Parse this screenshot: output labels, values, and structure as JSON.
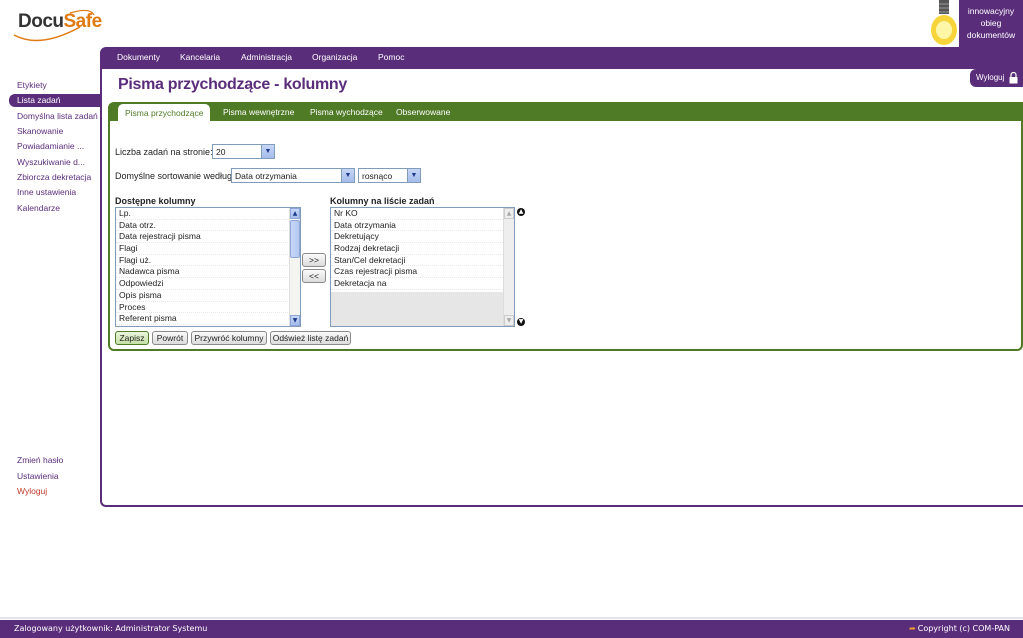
{
  "logo": {
    "part1": "Docu",
    "part2": "Safe"
  },
  "badge": {
    "line1": "innowacyjny",
    "line2": "obieg",
    "line3": "dokumentów"
  },
  "topnav": [
    "Dokumenty",
    "Kancelaria",
    "Administracja",
    "Organizacja",
    "Pomoc"
  ],
  "sidebar": {
    "items": [
      "Etykiety",
      "Lista zadań",
      "Domyślna lista zadań",
      "Skanowanie",
      "Powiadamianie ...",
      "Wyszukiwanie d...",
      "Zbiorcza dekretacja",
      "Inne ustawienia",
      "Kalendarze"
    ],
    "bottom": [
      "Zmień hasło",
      "Ustawienia",
      "Wyloguj"
    ]
  },
  "page_title": "Pisma przychodzące - kolumny",
  "logout_label": "Wyloguj",
  "tabs": [
    "Pisma przychodzące",
    "Pisma wewnętrzne",
    "Pisma wychodzące",
    "Obserwowane"
  ],
  "form": {
    "per_page_label": "Liczba zadań na stronie:",
    "per_page_value": "20",
    "sort_label": "Domyślne sortowanie według",
    "sort_field_value": "Data otrzymania",
    "sort_order_value": "rosnąco",
    "available_label": "Dostępne kolumny",
    "selected_label": "Kolumny na liście zadań",
    "available_columns": [
      "Lp.",
      "Data otrz.",
      "Data rejestracji pisma",
      "Flagi",
      "Flagi uż.",
      "Nadawca pisma",
      "Odpowiedzi",
      "Opis pisma",
      "Proces",
      "Referent pisma"
    ],
    "selected_columns": [
      "Nr KO",
      "Data otrzymania",
      "Dekretujący",
      "Rodzaj dekretacji",
      "Stan/Cel dekretacji",
      "Czas rejestracji pisma",
      "Dekretacja na"
    ],
    "move_right": ">>",
    "move_left": "<<",
    "buttons": {
      "save": "Zapisz",
      "back": "Powrót",
      "restore": "Przywróć kolumny",
      "refresh": "Odśwież listę zadań"
    }
  },
  "footer": {
    "user": "Zalogowany użytkownik: Administrator Systemu",
    "copyright": "Copyright (c) COM-PAN"
  },
  "colors": {
    "purple": "#5a2d7a",
    "green": "#4f7a26",
    "orange": "#e07a10"
  }
}
